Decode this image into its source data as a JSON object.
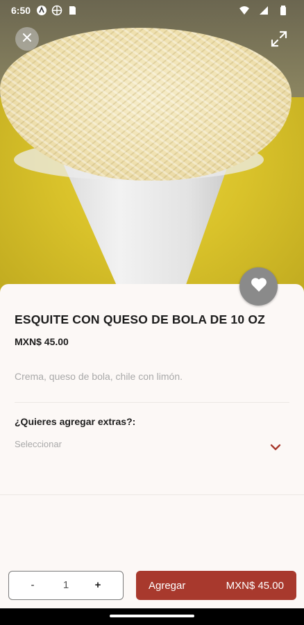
{
  "status_bar": {
    "time": "6:50",
    "left_icons": [
      "a-circle-icon",
      "network-icon",
      "sd-card-icon"
    ],
    "right_icons": [
      "wifi-icon",
      "cell-signal-icon",
      "battery-icon"
    ]
  },
  "product": {
    "title": "ESQUITE CON QUESO DE BOLA DE 10 OZ",
    "price": "MXN$ 45.00",
    "description": "Crema, queso de bola, chile con limón."
  },
  "extras": {
    "label": "¿Quieres agregar extras?:",
    "placeholder": "Seleccionar"
  },
  "quantity": {
    "minus_label": "-",
    "value": "1",
    "plus_label": "+"
  },
  "add_button": {
    "label": "Agregar",
    "amount": "MXN$ 45.00"
  },
  "colors": {
    "accent": "#a8392d",
    "sheet_background": "#fcf8f6",
    "muted_text": "#a9a9a9"
  }
}
